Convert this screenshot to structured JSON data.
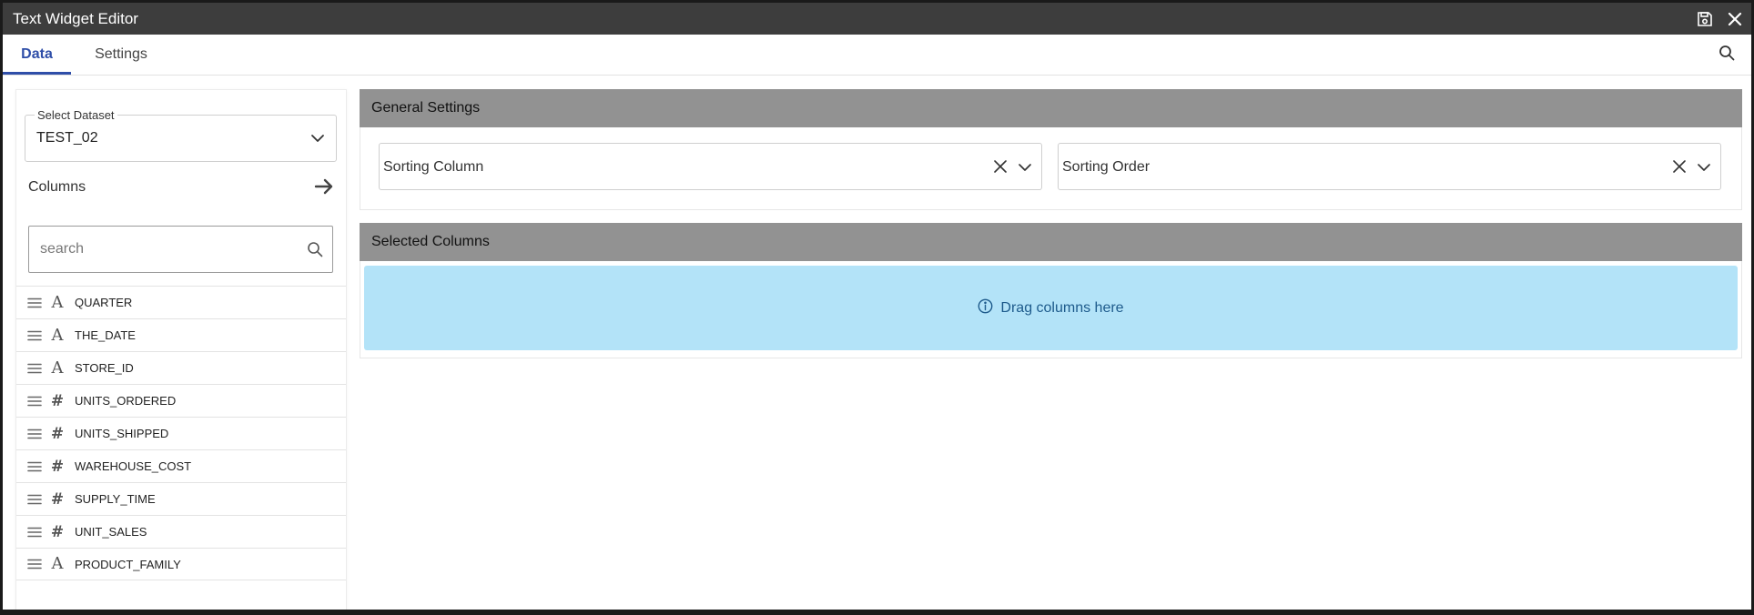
{
  "window": {
    "title": "Text Widget Editor",
    "title_bar_color": "#3d3d3d"
  },
  "icons": {
    "save": "save-icon",
    "close": "close-icon",
    "search": "search-icon",
    "arrow": "arrow-right-icon",
    "chevron": "chevron-down-icon",
    "clear": "clear-icon",
    "drag": "drag-handle-icon",
    "info": "info-icon"
  },
  "tabs": [
    {
      "label": "Data",
      "active": true
    },
    {
      "label": "Settings",
      "active": false
    }
  ],
  "accent_color": "#2f4ea8",
  "left_panel": {
    "dataset_label": "Select Dataset",
    "dataset_value": "TEST_02",
    "columns_label": "Columns",
    "search_placeholder": "search",
    "columns": [
      {
        "name": "QUARTER",
        "type": "A"
      },
      {
        "name": "THE_DATE",
        "type": "A"
      },
      {
        "name": "STORE_ID",
        "type": "A"
      },
      {
        "name": "UNITS_ORDERED",
        "type": "#"
      },
      {
        "name": "UNITS_SHIPPED",
        "type": "#"
      },
      {
        "name": "WAREHOUSE_COST",
        "type": "#"
      },
      {
        "name": "SUPPLY_TIME",
        "type": "#"
      },
      {
        "name": "UNIT_SALES",
        "type": "#"
      },
      {
        "name": "PRODUCT_FAMILY",
        "type": "A"
      }
    ]
  },
  "general_settings": {
    "title": "General Settings",
    "sorting_column_placeholder": "Sorting Column",
    "sorting_order_placeholder": "Sorting Order"
  },
  "selected_columns": {
    "title": "Selected Columns",
    "drop_hint": "Drag columns here",
    "drop_zone_color": "#b3e3f8"
  }
}
